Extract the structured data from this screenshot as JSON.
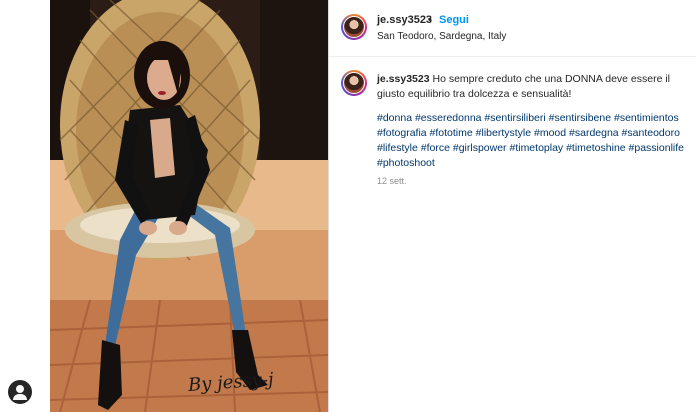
{
  "post": {
    "username": "je.ssy3523",
    "separator": "•",
    "follow_label": "Segui",
    "location": "San Teodoro, Sardegna, Italy",
    "more_icon": "•••"
  },
  "caption": {
    "username": "je.ssy3523",
    "text": "Ho sempre creduto che una DONNA deve essere il giusto equilibrio tra dolcezza e sensualità!",
    "hashtags": "#donna #esseredonna #sentirsiliberi #sentirsibene #sentimientos #fotografia #fototime #libertystyle #mood #sardegna #santeodoro #lifestyle #force #girlspower #timetoplay #timetoshine #passionlife #photoshoot",
    "timestamp": "12 sett."
  },
  "photo": {
    "signature": "By jessy-j",
    "icon": "photo-of-woman-in-hanging-chair"
  },
  "colors": {
    "link": "#00376b",
    "follow": "#0095f6",
    "text": "#262626",
    "muted": "#8e8e8e"
  }
}
